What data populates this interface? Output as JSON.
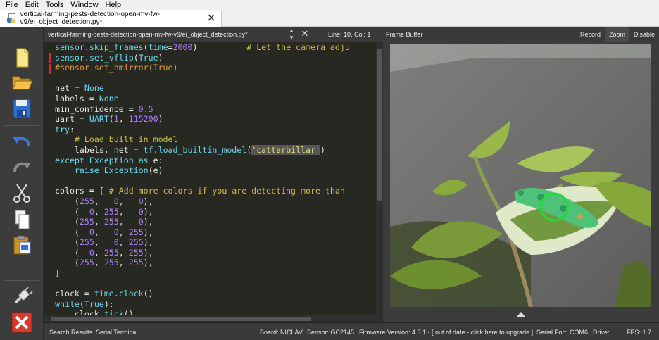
{
  "menu": [
    "File",
    "Edit",
    "Tools",
    "Window",
    "Help"
  ],
  "tab": {
    "title": "vertical-farming-pests-detection-open-mv-fw-v9/ei_object_detection.py*"
  },
  "toolbar": {
    "items": [
      "new-file-icon",
      "open-folder-icon",
      "save-icon",
      "undo-icon",
      "redo-icon",
      "cut-icon",
      "copy-icon",
      "paste-icon",
      "connect-plug-icon",
      "disconnect-icon"
    ]
  },
  "editor": {
    "filename": "vertical-farming-pests-detection-open-mv-fw-v9/ei_object_detection.py*",
    "position": "Line: 10, Col: 1",
    "code_lines": [
      "sensor.skip_frames(time=2000)          # Let the camera adju",
      "sensor.set_vflip(True)",
      "#sensor.set_hmirror(True)",
      "",
      "net = None",
      "labels = None",
      "min_confidence = 0.5",
      "uart = UART(1, 115200)",
      "try:",
      "    # Load built in model",
      "    labels, net = tf.load_builtin_model('cattarbillar')",
      "except Exception as e:",
      "    raise Exception(e)",
      "",
      "colors = [ # Add more colors if you are detecting more than",
      "    (255,   0,   0),",
      "    (  0, 255,   0),",
      "    (255, 255,   0),",
      "    (  0,   0, 255),",
      "    (255,   0, 255),",
      "    (  0, 255, 255),",
      "    (255, 255, 255),",
      "]",
      "",
      "clock = time.clock()",
      "while(True):",
      "    clock.tick()"
    ]
  },
  "framebuffer": {
    "title": "Frame Buffer",
    "buttons": [
      "Record",
      "Zoom",
      "Disable"
    ],
    "active_button": "Zoom"
  },
  "status": {
    "search_results": "Search Results",
    "serial_terminal": "Serial Terminal",
    "board": "Board: NICLAV",
    "sensor": "Sensor: GC2145",
    "firmware": "Firmware Version: 4.3.1 - [ out of date - click here to upgrade ]",
    "serial_port": "Serial Port: COM6",
    "drive": "Drive:",
    "fps": "FPS:   1.7"
  },
  "colors": {
    "editor_bg": "#272822",
    "keyword": "#66d9ef",
    "comment": "#ccbf4a",
    "number": "#ae81ff",
    "string": "#e6db74",
    "detection_box": "#22dd33"
  }
}
